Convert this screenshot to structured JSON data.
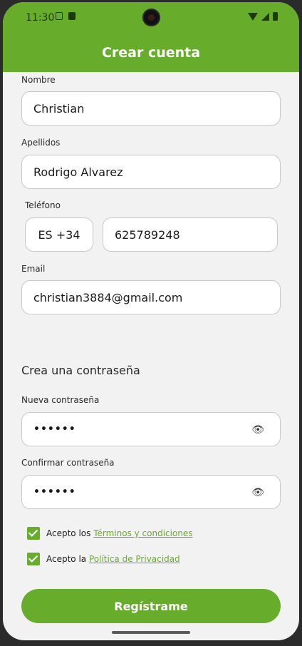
{
  "status_bar": {
    "time": "11:30"
  },
  "header": {
    "title": "Crear cuenta"
  },
  "form": {
    "nombre": {
      "label": "Nombre",
      "value": "Christian"
    },
    "apellidos": {
      "label": "Apellidos",
      "value": "Rodrigo Alvarez"
    },
    "telefono": {
      "label": "Teléfono",
      "country_code": "ES +34",
      "value": "625789248"
    },
    "email": {
      "label": "Email",
      "value": "christian3884@gmail.com"
    }
  },
  "password_section": {
    "title": "Crea una contraseña",
    "nueva": {
      "label": "Nueva contraseña",
      "value": "••••••"
    },
    "confirmar": {
      "label": "Confirmar contraseña",
      "value": "••••••"
    }
  },
  "consents": {
    "terms": {
      "prefix": "Acepto los ",
      "link": "Términos y condiciones",
      "checked": true
    },
    "privacy": {
      "prefix": "Acepto la ",
      "link": "Política de Privacidad",
      "checked": true
    }
  },
  "actions": {
    "register_label": "Regístrame"
  },
  "colors": {
    "accent": "#67ad2b",
    "background": "#f2f2f2"
  }
}
